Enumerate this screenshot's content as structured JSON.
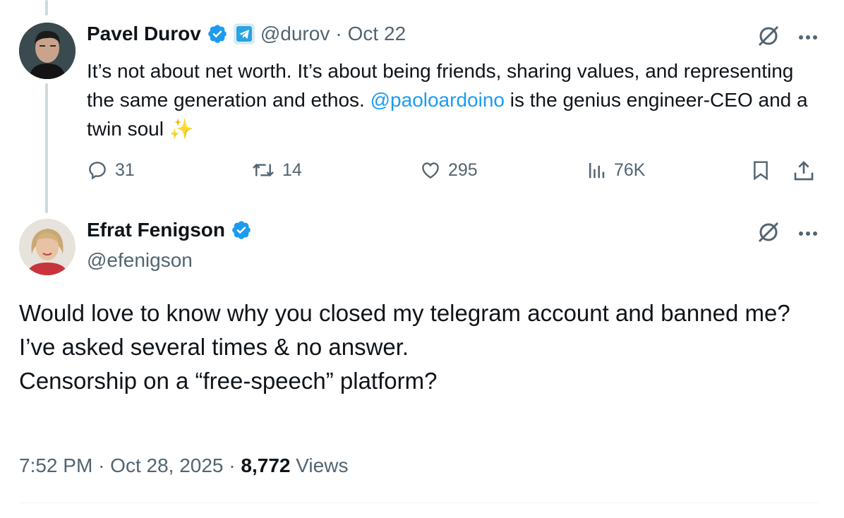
{
  "tweet1": {
    "name": "Pavel Durov",
    "handle": "@durov",
    "date": "Oct 22",
    "sep": "·",
    "text_part1": "It’s not about net worth. It’s about being friends, sharing values, and representing the same generation and ethos. ",
    "mention": "@paoloardoino",
    "text_part2": " is the genius engineer-CEO and a twin soul ",
    "emoji": "✨",
    "replies": "31",
    "reposts": "14",
    "likes": "295",
    "views": "76K"
  },
  "tweet2": {
    "name": "Efrat Fenigson",
    "handle": "@efenigson",
    "lines": [
      "Would love to know why you closed my telegram account and banned me?",
      "I’ve asked several times & no answer.",
      "Censorship on a “free-speech” platform?"
    ],
    "time": "7:52 PM",
    "date": "Oct 28, 2025",
    "sep": "·",
    "views_count": "8,772",
    "views_label": "Views"
  },
  "colors": {
    "accent": "#1d9bf0",
    "secondary_text": "#536471",
    "thread_line": "#cfd9de"
  },
  "icons": [
    "verified-badge-icon",
    "telegram-icon",
    "grok-icon",
    "more-icon",
    "reply-icon",
    "repost-icon",
    "like-icon",
    "views-icon",
    "bookmark-icon",
    "share-icon"
  ]
}
